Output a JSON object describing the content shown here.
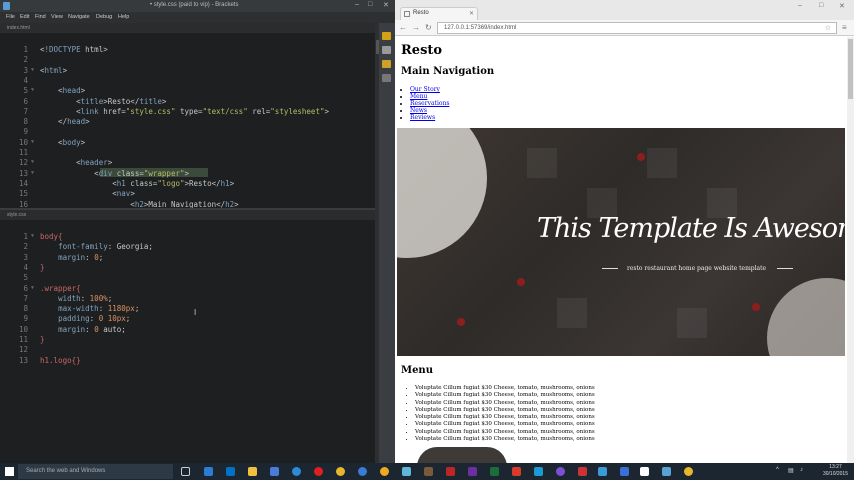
{
  "brackets": {
    "window_title": "• style.css (paid to vip) - Brackets",
    "menu": [
      "File",
      "Edit",
      "Find",
      "View",
      "Navigate",
      "Debug",
      "Help"
    ],
    "file1": {
      "name": "index.html",
      "lines": [
        {
          "n": "1",
          "code": "<!DOCTYPE html>"
        },
        {
          "n": "2",
          "code": ""
        },
        {
          "n": "3",
          "code": "<html>"
        },
        {
          "n": "4",
          "code": ""
        },
        {
          "n": "5",
          "code": "    <head>"
        },
        {
          "n": "6",
          "code": "        <title>Resto</title>"
        },
        {
          "n": "7",
          "code": "        <link href=\"style.css\" type=\"text/css\" rel=\"stylesheet\">"
        },
        {
          "n": "8",
          "code": "    </head>"
        },
        {
          "n": "9",
          "code": ""
        },
        {
          "n": "10",
          "code": "    <body>"
        },
        {
          "n": "11",
          "code": ""
        },
        {
          "n": "12",
          "code": "        <header>"
        },
        {
          "n": "13",
          "code": "            <div class=\"wrapper\">"
        },
        {
          "n": "14",
          "code": "                <h1 class=\"logo\">Resto</h1>"
        },
        {
          "n": "15",
          "code": "                <nav>"
        },
        {
          "n": "16",
          "code": "                    <h2>Main Navigation</h2>"
        }
      ]
    },
    "file2": {
      "name": "style.css",
      "lines": [
        {
          "n": "1",
          "code": "body{"
        },
        {
          "n": "2",
          "code": "    font-family: Georgia;"
        },
        {
          "n": "3",
          "code": "    margin: 0;"
        },
        {
          "n": "4",
          "code": "}"
        },
        {
          "n": "5",
          "code": ""
        },
        {
          "n": "6",
          "code": ".wrapper{"
        },
        {
          "n": "7",
          "code": "    width: 100%;"
        },
        {
          "n": "8",
          "code": "    max-width: 1180px;"
        },
        {
          "n": "9",
          "code": "    padding: 0 10px;"
        },
        {
          "n": "10",
          "code": "    margin: 0 auto;"
        },
        {
          "n": "11",
          "code": "}"
        },
        {
          "n": "12",
          "code": ""
        },
        {
          "n": "13",
          "code": "h1.logo{}"
        }
      ]
    }
  },
  "browser": {
    "tab_title": "Resto",
    "url": "127.0.0.1:57369/index.html",
    "page": {
      "site_title": "Resto",
      "nav_heading": "Main Navigation",
      "nav_items": [
        "Our Story",
        "Menu",
        "Reservations",
        "News",
        "Reviews"
      ],
      "hero_title": "This Template Is Awesome",
      "hero_subtitle": "resto restaurant home page website template",
      "menu_heading": "Menu",
      "menu_items": [
        "Voluptate Cillum fugiat $30 Cheese, tomato, mushrooms, onions",
        "Voluptate Cillum fugiat $30 Cheese, tomato, mushrooms, onions",
        "Voluptate Cillum fugiat $30 Cheese, tomato, mushrooms, onions",
        "Voluptate Cillum fugiat $30 Cheese, tomato, mushrooms, onions",
        "Voluptate Cillum fugiat $30 Cheese, tomato, mushrooms, onions",
        "Voluptate Cillum fugiat $30 Cheese, tomato, mushrooms, onions",
        "Voluptate Cillum fugiat $30 Cheese, tomato, mushrooms, onions",
        "Voluptate Cillum fugiat $30 Cheese, tomato, mushrooms, onions"
      ]
    }
  },
  "taskbar": {
    "search_placeholder": "Search the web and Windows",
    "time": "13:27",
    "date": "30/10/2015"
  },
  "colors": {
    "editor_bg": "#1d1f21",
    "tag": "#81a2be",
    "string": "#b5bd68",
    "number": "#de935f",
    "selector": "#cc6666",
    "taskbar": "#1c2630"
  }
}
